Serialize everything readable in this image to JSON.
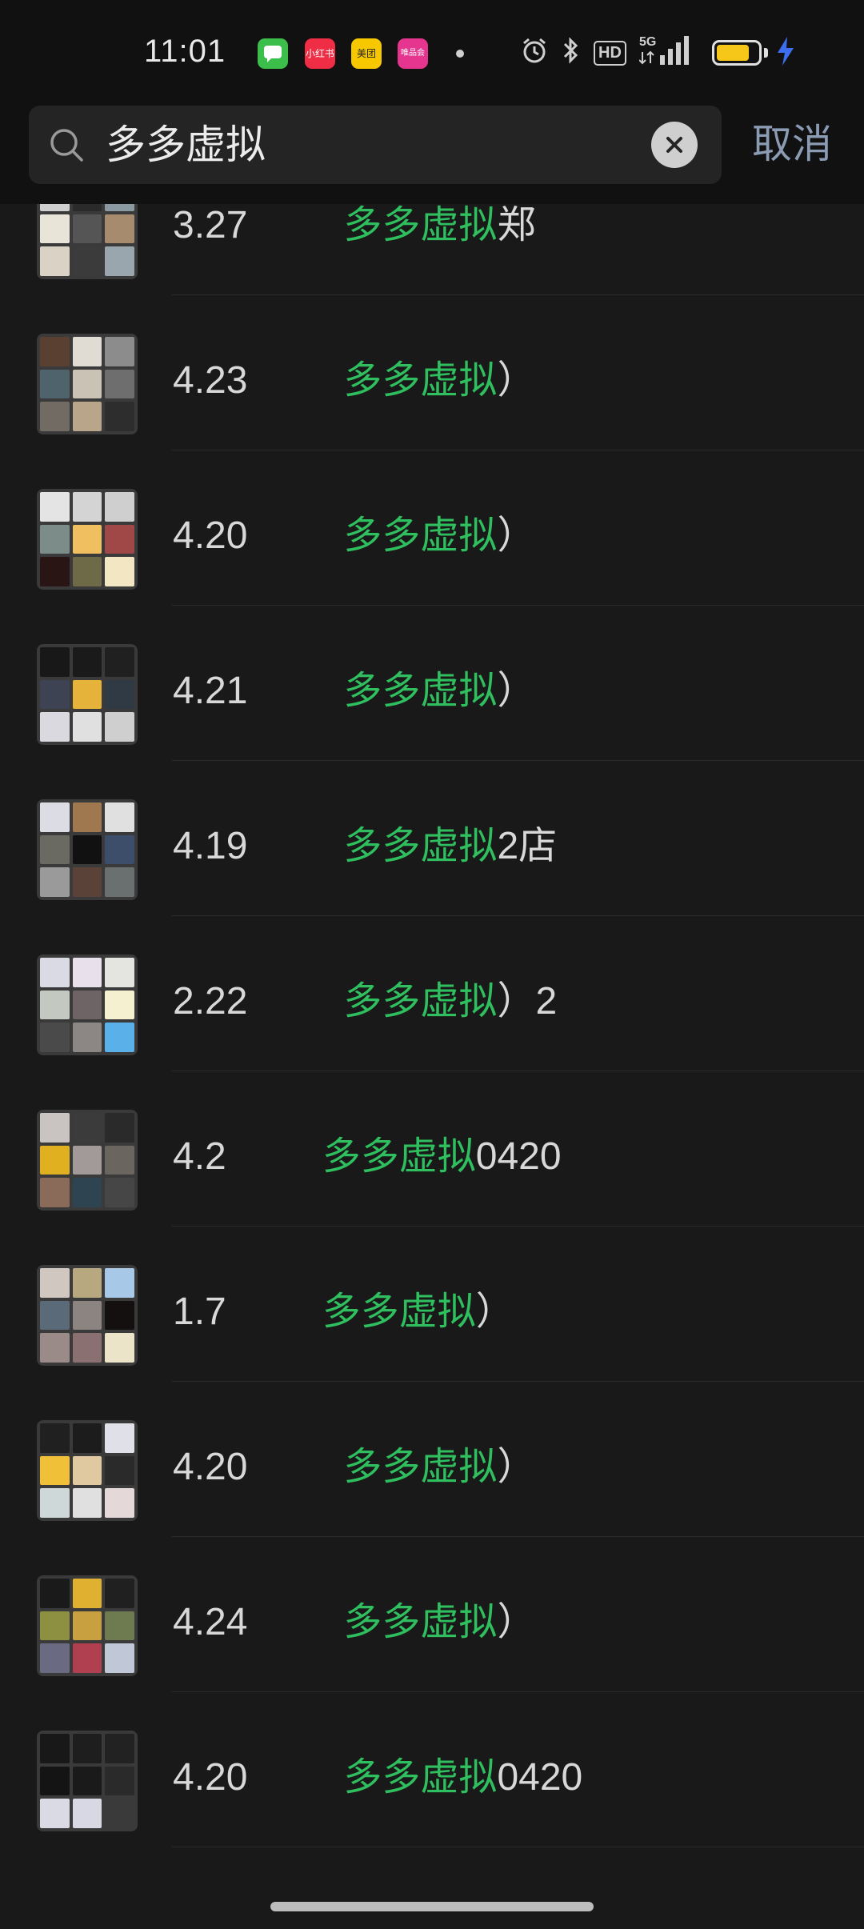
{
  "status_bar": {
    "time": "11:01",
    "app_icons": [
      {
        "name": "messages-app-icon",
        "label": "",
        "color": "#3bbf4a"
      },
      {
        "name": "xiaohongshu-app-icon",
        "label": "小红书",
        "color": "#ef2d45"
      },
      {
        "name": "meituan-app-icon",
        "label": "美团",
        "color": "#f7c800"
      },
      {
        "name": "weipinhui-app-icon",
        "label": "唯品会",
        "color": "#e5358f"
      }
    ],
    "network": "5G",
    "hd_label": "HD",
    "battery_level": 0.8,
    "battery_color": "#f6c619"
  },
  "search": {
    "query": "多多虚拟",
    "cancel_label": "取消"
  },
  "colors": {
    "highlight": "#2fbf5f",
    "background": "#191919"
  },
  "results": [
    {
      "prefix": "3.27",
      "highlight": "多多虚拟",
      "suffix": "郑"
    },
    {
      "prefix": "4.23",
      "highlight": "多多虚拟",
      "suffix": "）"
    },
    {
      "prefix": "4.20",
      "highlight": "多多虚拟",
      "suffix": "）"
    },
    {
      "prefix": "4.21",
      "highlight": "多多虚拟",
      "suffix": "）"
    },
    {
      "prefix": "4.19",
      "highlight": "多多虚拟",
      "suffix": "2店"
    },
    {
      "prefix": "2.22",
      "highlight": "多多虚拟",
      "suffix": "）2"
    },
    {
      "prefix": "4.2",
      "highlight": "多多虚拟",
      "suffix": "0420"
    },
    {
      "prefix": "1.7",
      "highlight": "多多虚拟",
      "suffix": "）"
    },
    {
      "prefix": "4.20",
      "highlight": "多多虚拟",
      "suffix": "）"
    },
    {
      "prefix": "4.24",
      "highlight": "多多虚拟",
      "suffix": "）"
    },
    {
      "prefix": "4.20",
      "highlight": "多多虚拟",
      "suffix": "0420"
    }
  ]
}
